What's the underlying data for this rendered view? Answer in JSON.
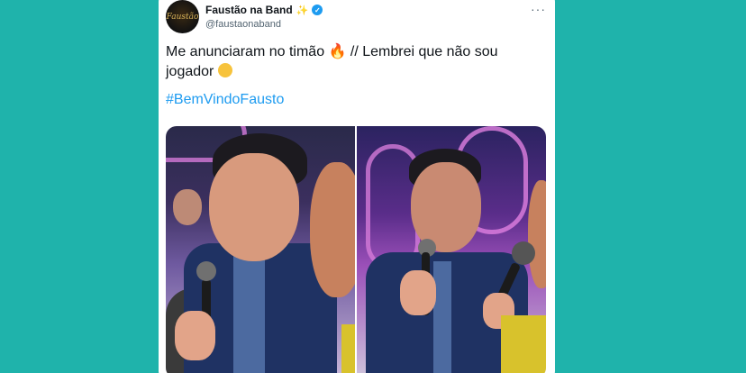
{
  "tweet": {
    "display_name": "Faustão na Band",
    "handle": "@faustaonaband",
    "avatar_text": "Faustão",
    "more_label": "···",
    "text_line1_a": "Me anunciaram no timão ",
    "text_line1_emoji": "🔥",
    "text_line1_b": " // Lembrei que não sou",
    "text_line2": "jogador ",
    "hashtag": "#BemVindoFausto"
  },
  "icons": {
    "sparkle": "sparkle-icon",
    "verified": "verified-icon",
    "more": "more-icon",
    "fire": "fire-emoji",
    "persevere": "persevering-face-emoji"
  },
  "colors": {
    "background": "#1fb3ab",
    "card": "#ffffff",
    "hashtag": "#1d9bf0",
    "verified": "#1d9bf0"
  }
}
